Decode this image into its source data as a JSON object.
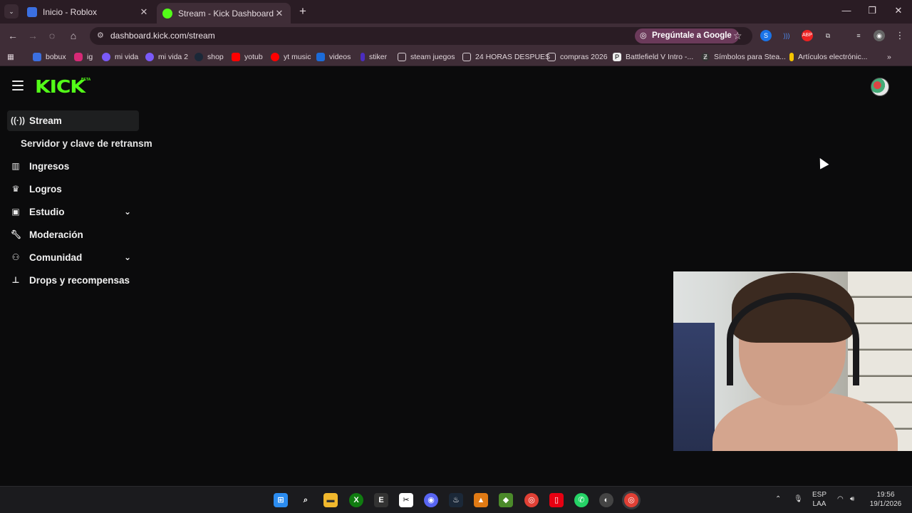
{
  "browser": {
    "tabs": [
      {
        "title": "Inicio - Roblox",
        "favicon_color": "#3b6fe0"
      },
      {
        "title": "Stream - Kick Dashboard",
        "favicon_color": "#53fc18"
      }
    ],
    "url": "dashboard.kick.com/stream",
    "ask_google": "Pregúntale a Google",
    "window_controls": {
      "minimize": "—",
      "maximize": "❐",
      "close": "✕"
    }
  },
  "bookmarks": [
    {
      "label": "bobux",
      "color": "#3b6fe0"
    },
    {
      "label": "ig",
      "color": "#d62976"
    },
    {
      "label": "mi vida",
      "color": "#7a5af8"
    },
    {
      "label": "mi vida 2",
      "color": "#7a5af8"
    },
    {
      "label": "shop",
      "color": "#1b2838"
    },
    {
      "label": "yotub",
      "color": "#ff0000"
    },
    {
      "label": "yt music",
      "color": "#ff0000"
    },
    {
      "label": "videos",
      "color": "#1c6bd8"
    },
    {
      "label": "stiker",
      "color": "#4b2dbf"
    },
    {
      "label": "steam juegos",
      "color": "#3f2d37"
    },
    {
      "label": "24 HORAS DESPUES",
      "color": "#3f2d37"
    },
    {
      "label": "compras 2026",
      "color": "#3f2d37"
    },
    {
      "label": "Battlefield V Intro -...",
      "color": "#eeeeee"
    },
    {
      "label": "Símbolos para Stea...",
      "color": "#333333"
    },
    {
      "label": "Artículos electrónic...",
      "color": "#f5c400"
    }
  ],
  "kick": {
    "logo": "KICK",
    "beta": "BETA",
    "nav": [
      {
        "label": "Stream",
        "icon": "broadcast-icon",
        "active": true
      },
      {
        "label": "Servidor y clave de retransm",
        "sub": true
      },
      {
        "label": "Ingresos",
        "icon": "bar-chart-icon"
      },
      {
        "label": "Logros",
        "icon": "trophy-icon"
      },
      {
        "label": "Estudio",
        "icon": "studio-icon",
        "expandable": true
      },
      {
        "label": "Moderación",
        "icon": "wrench-icon"
      },
      {
        "label": "Comunidad",
        "icon": "community-icon",
        "expandable": true
      },
      {
        "label": "Drops y recompensas",
        "icon": "drops-icon"
      }
    ]
  },
  "taskbar": {
    "lang": "ESP",
    "lang2": "LAA",
    "time": "19:56",
    "date": "19/1/2026"
  }
}
